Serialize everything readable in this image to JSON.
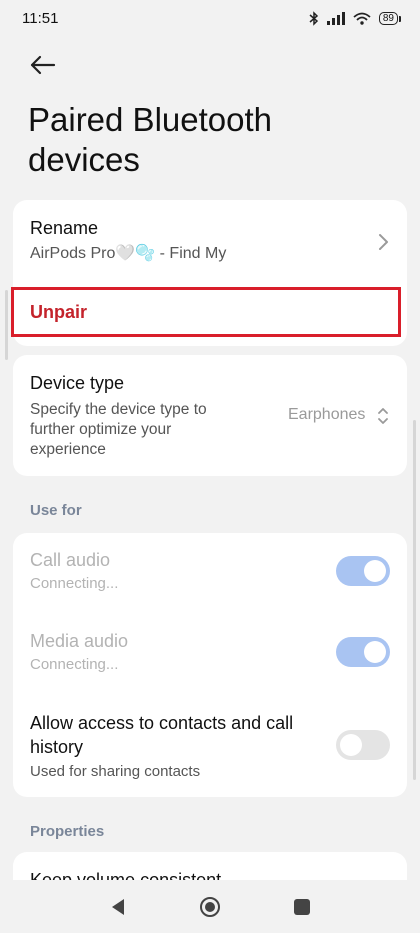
{
  "status_bar": {
    "time": "11:51",
    "battery": "89"
  },
  "page": {
    "title": "Paired Bluetooth devices"
  },
  "device_card": {
    "rename_title": "Rename",
    "device_name": "AirPods Pro🤍🫧 - Find My",
    "unpair_label": "Unpair"
  },
  "device_type": {
    "title": "Device type",
    "description": "Specify the device type to further optimize your experience",
    "value": "Earphones"
  },
  "use_for": {
    "label": "Use for",
    "items": [
      {
        "title": "Call audio",
        "subtitle": "Connecting...",
        "state": "on",
        "enabled": false
      },
      {
        "title": "Media audio",
        "subtitle": "Connecting...",
        "state": "on",
        "enabled": false
      },
      {
        "title": "Allow access to contacts and call history",
        "subtitle": "Used for sharing contacts",
        "state": "off",
        "enabled": true
      }
    ]
  },
  "properties": {
    "label": "Properties",
    "items": [
      {
        "title": "Keep volume consistent"
      }
    ]
  },
  "colors": {
    "background": "#f2f2f2",
    "unpair_text": "#c4232b",
    "highlight_border": "#d91e2a",
    "toggle_on": "#a9c4f2",
    "toggle_off": "#e4e4e4",
    "section_label": "#7a8699"
  },
  "icons": [
    "back-arrow-icon",
    "chevron-right-icon",
    "up-down-chevron-icon",
    "bluetooth-icon",
    "signal-icon",
    "wifi-icon",
    "battery-icon",
    "nav-back-icon",
    "nav-home-icon",
    "nav-recents-icon"
  ]
}
